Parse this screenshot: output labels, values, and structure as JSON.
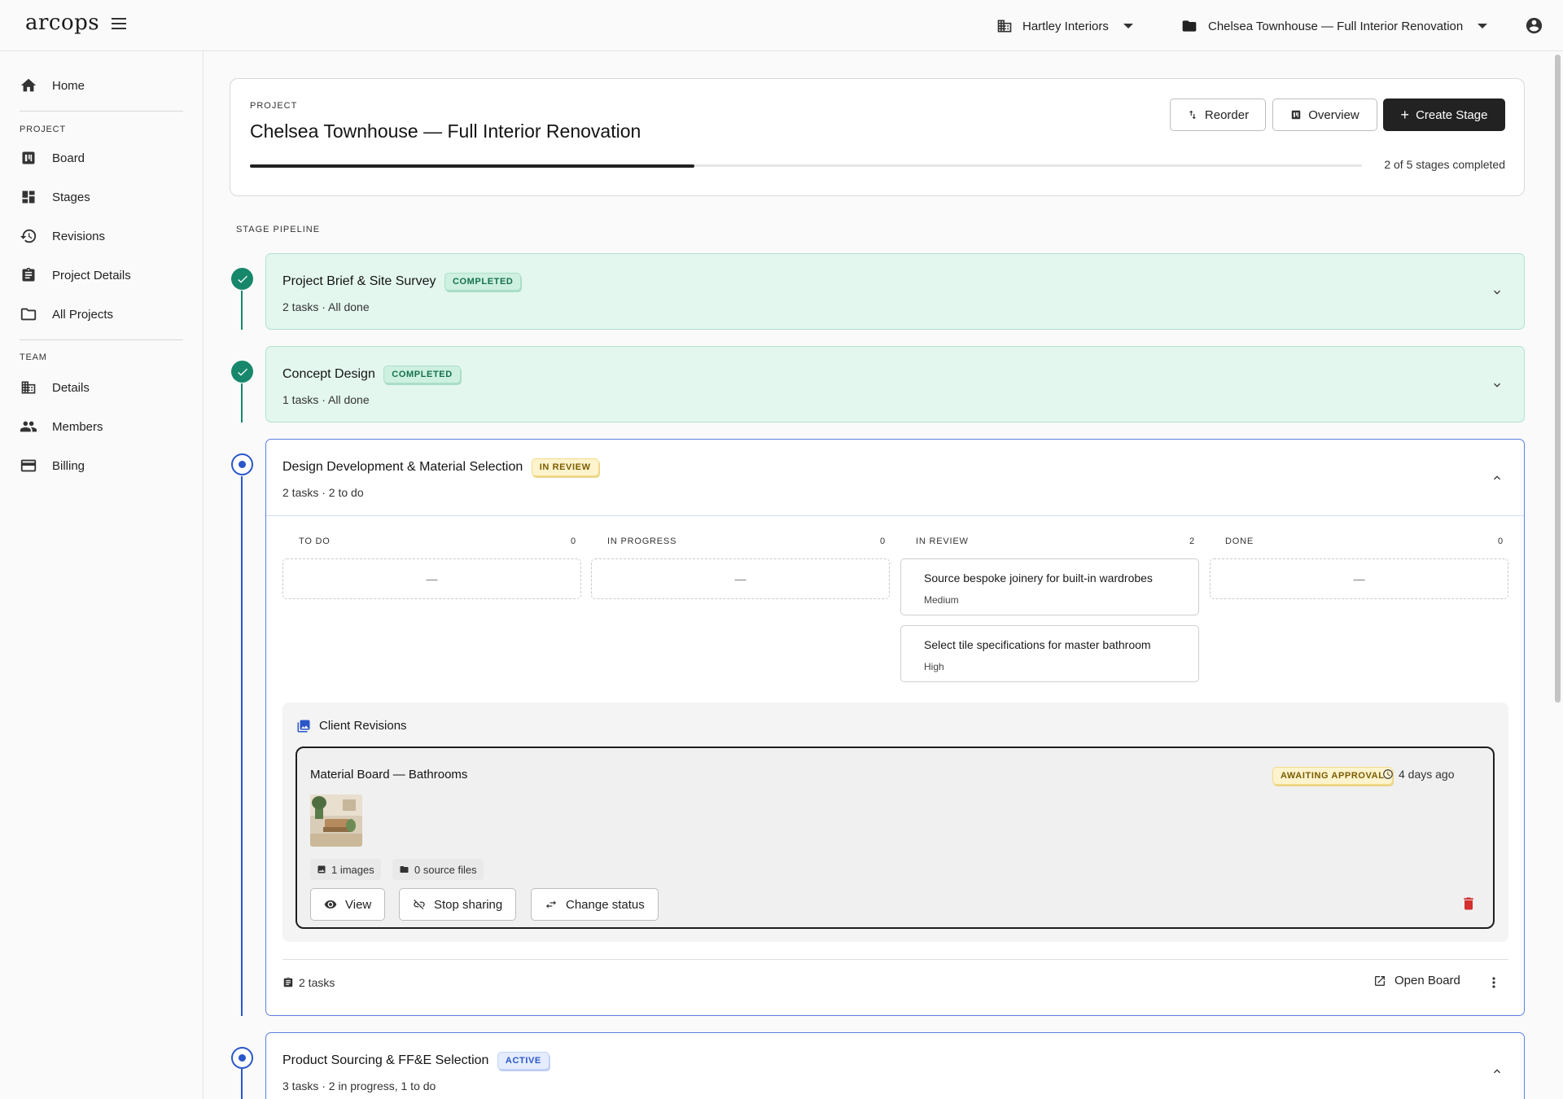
{
  "app": {
    "logo": "arcops"
  },
  "topbar": {
    "org": "Hartley Interiors",
    "project": "Chelsea Townhouse — Full Interior Renovation"
  },
  "sidebar": {
    "home": "Home",
    "project_section": "PROJECT",
    "project_items": [
      "Board",
      "Stages",
      "Revisions",
      "Project Details",
      "All Projects"
    ],
    "team_section": "TEAM",
    "team_items": [
      "Details",
      "Members",
      "Billing"
    ]
  },
  "header": {
    "eyebrow": "PROJECT",
    "title": "Chelsea Townhouse — Full Interior Renovation",
    "reorder": "Reorder",
    "overview": "Overview",
    "create_stage": "Create Stage",
    "progress_text": "2 of 5 stages completed",
    "progress_fraction": 0.4
  },
  "pipeline_label": "STAGE PIPELINE",
  "stages": [
    {
      "title": "Project Brief & Site Survey",
      "status": "COMPLETED",
      "summary": "2 tasks · All done"
    },
    {
      "title": "Concept Design",
      "status": "COMPLETED",
      "summary": "1 tasks · All done"
    },
    {
      "title": "Design Development & Material Selection",
      "status": "IN REVIEW",
      "summary": "2 tasks · 2 to do",
      "columns": [
        {
          "name": "TO DO",
          "count": "0",
          "empty": "—"
        },
        {
          "name": "IN PROGRESS",
          "count": "0",
          "empty": "—"
        },
        {
          "name": "IN REVIEW",
          "count": "2"
        },
        {
          "name": "DONE",
          "count": "0",
          "empty": "—"
        }
      ],
      "review_tasks": [
        {
          "title": "Source bespoke joinery for built-in wardrobes",
          "priority": "Medium"
        },
        {
          "title": "Select tile specifications for master bathroom",
          "priority": "High"
        }
      ],
      "revisions": {
        "heading": "Client Revisions",
        "card": {
          "title": "Material Board — Bathrooms",
          "status": "AWAITING APPROVAL",
          "time": "4 days ago",
          "images": "1 images",
          "source_files": "0 source files",
          "view": "View",
          "stop_sharing": "Stop sharing",
          "change_status": "Change status"
        }
      },
      "footer": {
        "tasks": "2 tasks",
        "open_board": "Open Board"
      }
    },
    {
      "title": "Product Sourcing & FF&E Selection",
      "status": "ACTIVE",
      "summary": "3 tasks · 2 in progress, 1 to do"
    }
  ],
  "colors": {
    "accent_blue": "#2a56c9",
    "done_green": "#17876b",
    "danger": "#d32f2f"
  }
}
